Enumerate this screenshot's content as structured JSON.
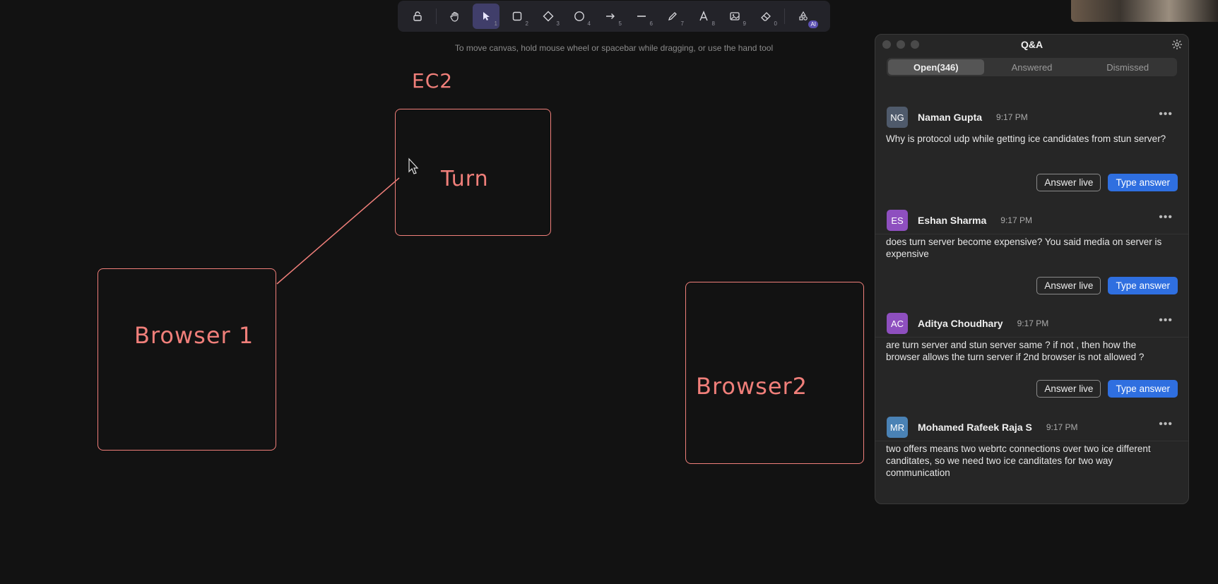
{
  "toolbar": {
    "tools": [
      {
        "name": "lock",
        "key": ""
      },
      {
        "name": "hand",
        "key": ""
      },
      {
        "name": "selection",
        "key": "1"
      },
      {
        "name": "rectangle",
        "key": "2"
      },
      {
        "name": "diamond",
        "key": "3"
      },
      {
        "name": "ellipse",
        "key": "4"
      },
      {
        "name": "arrow",
        "key": "5"
      },
      {
        "name": "line",
        "key": "6"
      },
      {
        "name": "draw",
        "key": "7"
      },
      {
        "name": "text",
        "key": "8"
      },
      {
        "name": "image",
        "key": "9"
      },
      {
        "name": "eraser",
        "key": "0"
      },
      {
        "name": "more-tools",
        "badge": "AI"
      }
    ],
    "active_tool": "selection",
    "hint": "To move canvas, hold mouse wheel or spacebar while dragging, or use the hand tool"
  },
  "canvas": {
    "labels": {
      "ec2": "EC2",
      "turn": "Turn",
      "browser1": "Browser 1",
      "browser2": "Browser2"
    },
    "stroke_color": "#f07f7a"
  },
  "qa": {
    "title": "Q&A",
    "tabs": [
      "Open(346)",
      "Answered",
      "Dismissed"
    ],
    "active_tab": "Open(346)",
    "questions": [
      {
        "initials": "NG",
        "avatar_color": "#4f5a6b",
        "name": "Naman Gupta",
        "time": "9:17 PM",
        "text": "Why is protocol udp while getting ice candidates from stun server?"
      },
      {
        "initials": "ES",
        "avatar_color": "#8e4fbf",
        "name": "Eshan Sharma",
        "time": "9:17 PM",
        "text": "does turn server become expensive? You said media on server is expensive"
      },
      {
        "initials": "AC",
        "avatar_color": "#8e4fbf",
        "name": "Aditya Choudhary",
        "time": "9:17 PM",
        "text": "are turn server and stun server same ? if not , then how the browser allows the turn server if 2nd browser is not allowed ?"
      },
      {
        "initials": "MR",
        "avatar_color": "#4a82b5",
        "name": "Mohamed Rafeek Raja S",
        "time": "9:17 PM",
        "text": "two offers means two webrtc connections over two ice different canditates, so we need two ice canditates for two way communication"
      }
    ],
    "answer_live_label": "Answer live",
    "type_answer_label": "Type answer",
    "accent": "#2f6fe0"
  }
}
